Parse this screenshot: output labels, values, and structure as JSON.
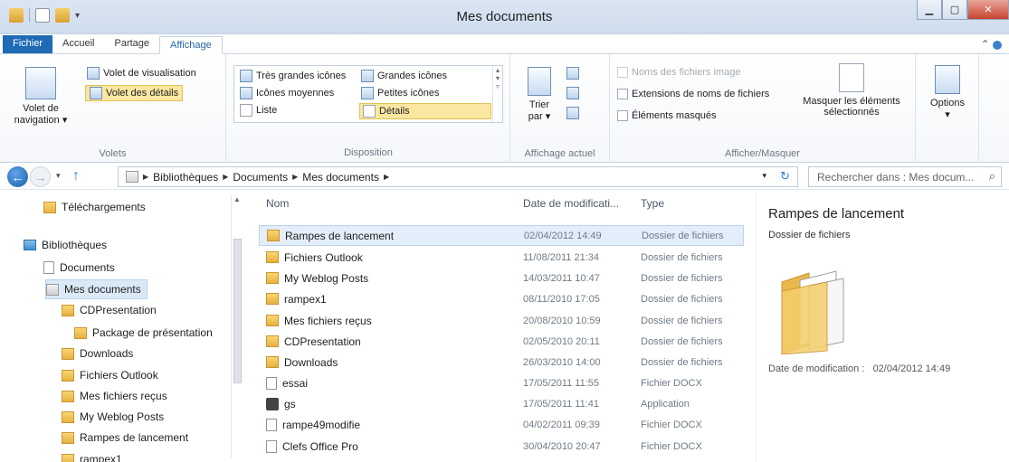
{
  "window": {
    "title": "Mes documents"
  },
  "ribbon_tabs": [
    "Fichier",
    "Accueil",
    "Partage",
    "Affichage"
  ],
  "ribbon": {
    "panes": {
      "nav_pane_label_line1": "Volet de",
      "nav_pane_label_line2": "navigation ▾",
      "preview_pane": "Volet de visualisation",
      "details_pane": "Volet des détails",
      "group_label": "Volets"
    },
    "layout": {
      "extra_large": "Très grandes icônes",
      "large": "Grandes icônes",
      "medium": "Icônes moyennes",
      "small": "Petites icônes",
      "list": "Liste",
      "details": "Détails",
      "group_label": "Disposition"
    },
    "current_view": {
      "sort_line1": "Trier",
      "sort_line2": "par ▾",
      "group_label": "Affichage actuel"
    },
    "show_hide": {
      "image_names": "Noms des fichiers image",
      "extensions": "Extensions de noms de fichiers",
      "hidden_items": "Éléments masqués",
      "hide_selected_line1": "Masquer les éléments",
      "hide_selected_line2": "sélectionnés",
      "group_label": "Afficher/Masquer"
    },
    "options": "Options"
  },
  "address": {
    "crumbs": [
      "Bibliothèques",
      "Documents",
      "Mes documents"
    ],
    "search_placeholder": "Rechercher dans : Mes docum..."
  },
  "nav_tree": [
    {
      "label": "Téléchargements",
      "icon": "folder"
    },
    {
      "label": "Bibliothèques",
      "icon": "library"
    },
    {
      "label": "Documents",
      "icon": "doc"
    },
    {
      "label": "Mes documents",
      "icon": "folder",
      "selected": true
    },
    {
      "label": "CDPresentation",
      "icon": "folder"
    },
    {
      "label": "Package de présentation",
      "icon": "folder"
    },
    {
      "label": "Downloads",
      "icon": "folder"
    },
    {
      "label": "Fichiers Outlook",
      "icon": "folder"
    },
    {
      "label": "Mes fichiers reçus",
      "icon": "folder"
    },
    {
      "label": "My Weblog Posts",
      "icon": "folder"
    },
    {
      "label": "Rampes de lancement",
      "icon": "folder"
    },
    {
      "label": "rampex1",
      "icon": "folder"
    }
  ],
  "columns": {
    "name": "Nom",
    "date": "Date de modificati...",
    "type": "Type"
  },
  "files": [
    {
      "name": "Rampes de lancement",
      "date": "02/04/2012 14:49",
      "type": "Dossier de fichiers",
      "icon": "folder",
      "selected": true
    },
    {
      "name": "Fichiers Outlook",
      "date": "11/08/2011 21:34",
      "type": "Dossier de fichiers",
      "icon": "folder"
    },
    {
      "name": "My Weblog Posts",
      "date": "14/03/2011 10:47",
      "type": "Dossier de fichiers",
      "icon": "folder"
    },
    {
      "name": "rampex1",
      "date": "08/11/2010 17:05",
      "type": "Dossier de fichiers",
      "icon": "folder"
    },
    {
      "name": "Mes fichiers reçus",
      "date": "20/08/2010 10:59",
      "type": "Dossier de fichiers",
      "icon": "folder"
    },
    {
      "name": "CDPresentation",
      "date": "02/05/2010 20:11",
      "type": "Dossier de fichiers",
      "icon": "folder"
    },
    {
      "name": "Downloads",
      "date": "26/03/2010 14:00",
      "type": "Dossier de fichiers",
      "icon": "folder"
    },
    {
      "name": "essai",
      "date": "17/05/2011 11:55",
      "type": "Fichier DOCX",
      "icon": "doc"
    },
    {
      "name": "gs",
      "date": "17/05/2011 11:41",
      "type": "Application",
      "icon": "app"
    },
    {
      "name": "rampe49modifie",
      "date": "04/02/2011 09:39",
      "type": "Fichier DOCX",
      "icon": "doc"
    },
    {
      "name": "Clefs Office Pro",
      "date": "30/04/2010 20:47",
      "type": "Fichier DOCX",
      "icon": "doc"
    }
  ],
  "details_pane": {
    "title": "Rampes de lancement",
    "type": "Dossier de fichiers",
    "modified_label": "Date de modification :",
    "modified_value": "02/04/2012 14:49"
  }
}
